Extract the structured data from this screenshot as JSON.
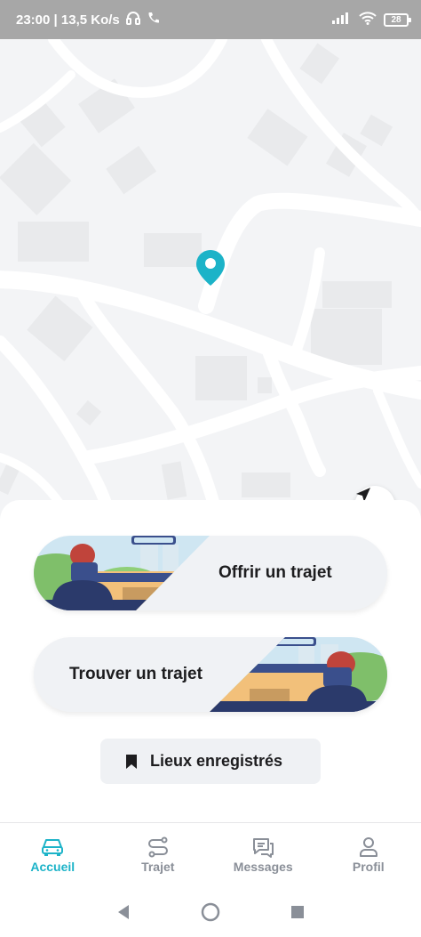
{
  "status_bar": {
    "time_speed": "23:00 | 13,5 Ko/s",
    "battery": "28",
    "icons": [
      "headset-icon",
      "phone-call-icon",
      "signal-icon",
      "wifi-icon",
      "battery-icon"
    ]
  },
  "map": {
    "pin_icon": "location-pin-icon",
    "locate_icon": "navigation-arrow-icon",
    "accent_color": "#1cb3c8"
  },
  "actions": {
    "offer_label": "Offrir un trajet",
    "find_label": "Trouver un trajet",
    "saved_places_label": "Lieux enregistrés",
    "saved_icon": "bookmark-icon"
  },
  "tabs": [
    {
      "label": "Accueil",
      "icon": "car-icon",
      "active": true
    },
    {
      "label": "Trajet",
      "icon": "route-icon",
      "active": false
    },
    {
      "label": "Messages",
      "icon": "chat-icon",
      "active": false
    },
    {
      "label": "Profil",
      "icon": "user-icon",
      "active": false
    }
  ],
  "system_nav": [
    "back-icon",
    "home-icon",
    "recents-icon"
  ]
}
